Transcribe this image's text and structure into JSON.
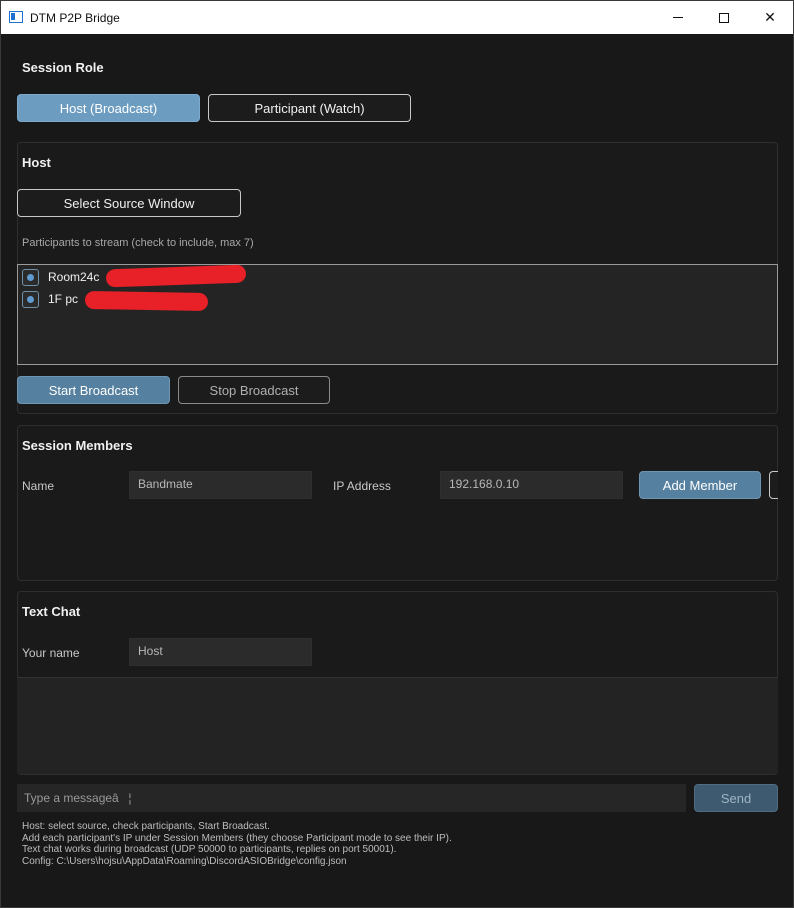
{
  "window": {
    "title": "DTM P2P Bridge"
  },
  "session_role": {
    "heading": "Session Role",
    "host_button": "Host (Broadcast)",
    "participant_button": "Participant (Watch)"
  },
  "host": {
    "heading": "Host",
    "select_source_button": "Select Source Window",
    "participants_hint": "Participants to stream (check to include, max 7)",
    "participants": [
      {
        "name": "Room24c",
        "checked": true
      },
      {
        "name": "1F pc",
        "checked": true
      }
    ],
    "start_button": "Start Broadcast",
    "stop_button": "Stop Broadcast"
  },
  "members": {
    "heading": "Session Members",
    "name_label": "Name",
    "name_value": "Bandmate",
    "ip_label": "IP Address",
    "ip_value": "192.168.0.10",
    "add_button": "Add Member"
  },
  "chat": {
    "heading": "Text Chat",
    "your_name_label": "Your name",
    "your_name_value": "Host",
    "message_placeholder": "Type a messageâ¦",
    "send_button": "Send"
  },
  "help_lines": [
    "Host: select source, check participants, Start Broadcast.",
    "Add each participant's IP under Session Members (they choose Participant mode to see their IP).",
    "Text chat works during broadcast (UDP 50000 to participants, replies on port 50001).",
    "Config: C:\\Users\\hojsu\\AppData\\Roaming\\DiscordASIOBridge\\config.json"
  ],
  "colors": {
    "accent": "#6d9cc1",
    "background": "#181818",
    "redaction": "#e82027"
  }
}
